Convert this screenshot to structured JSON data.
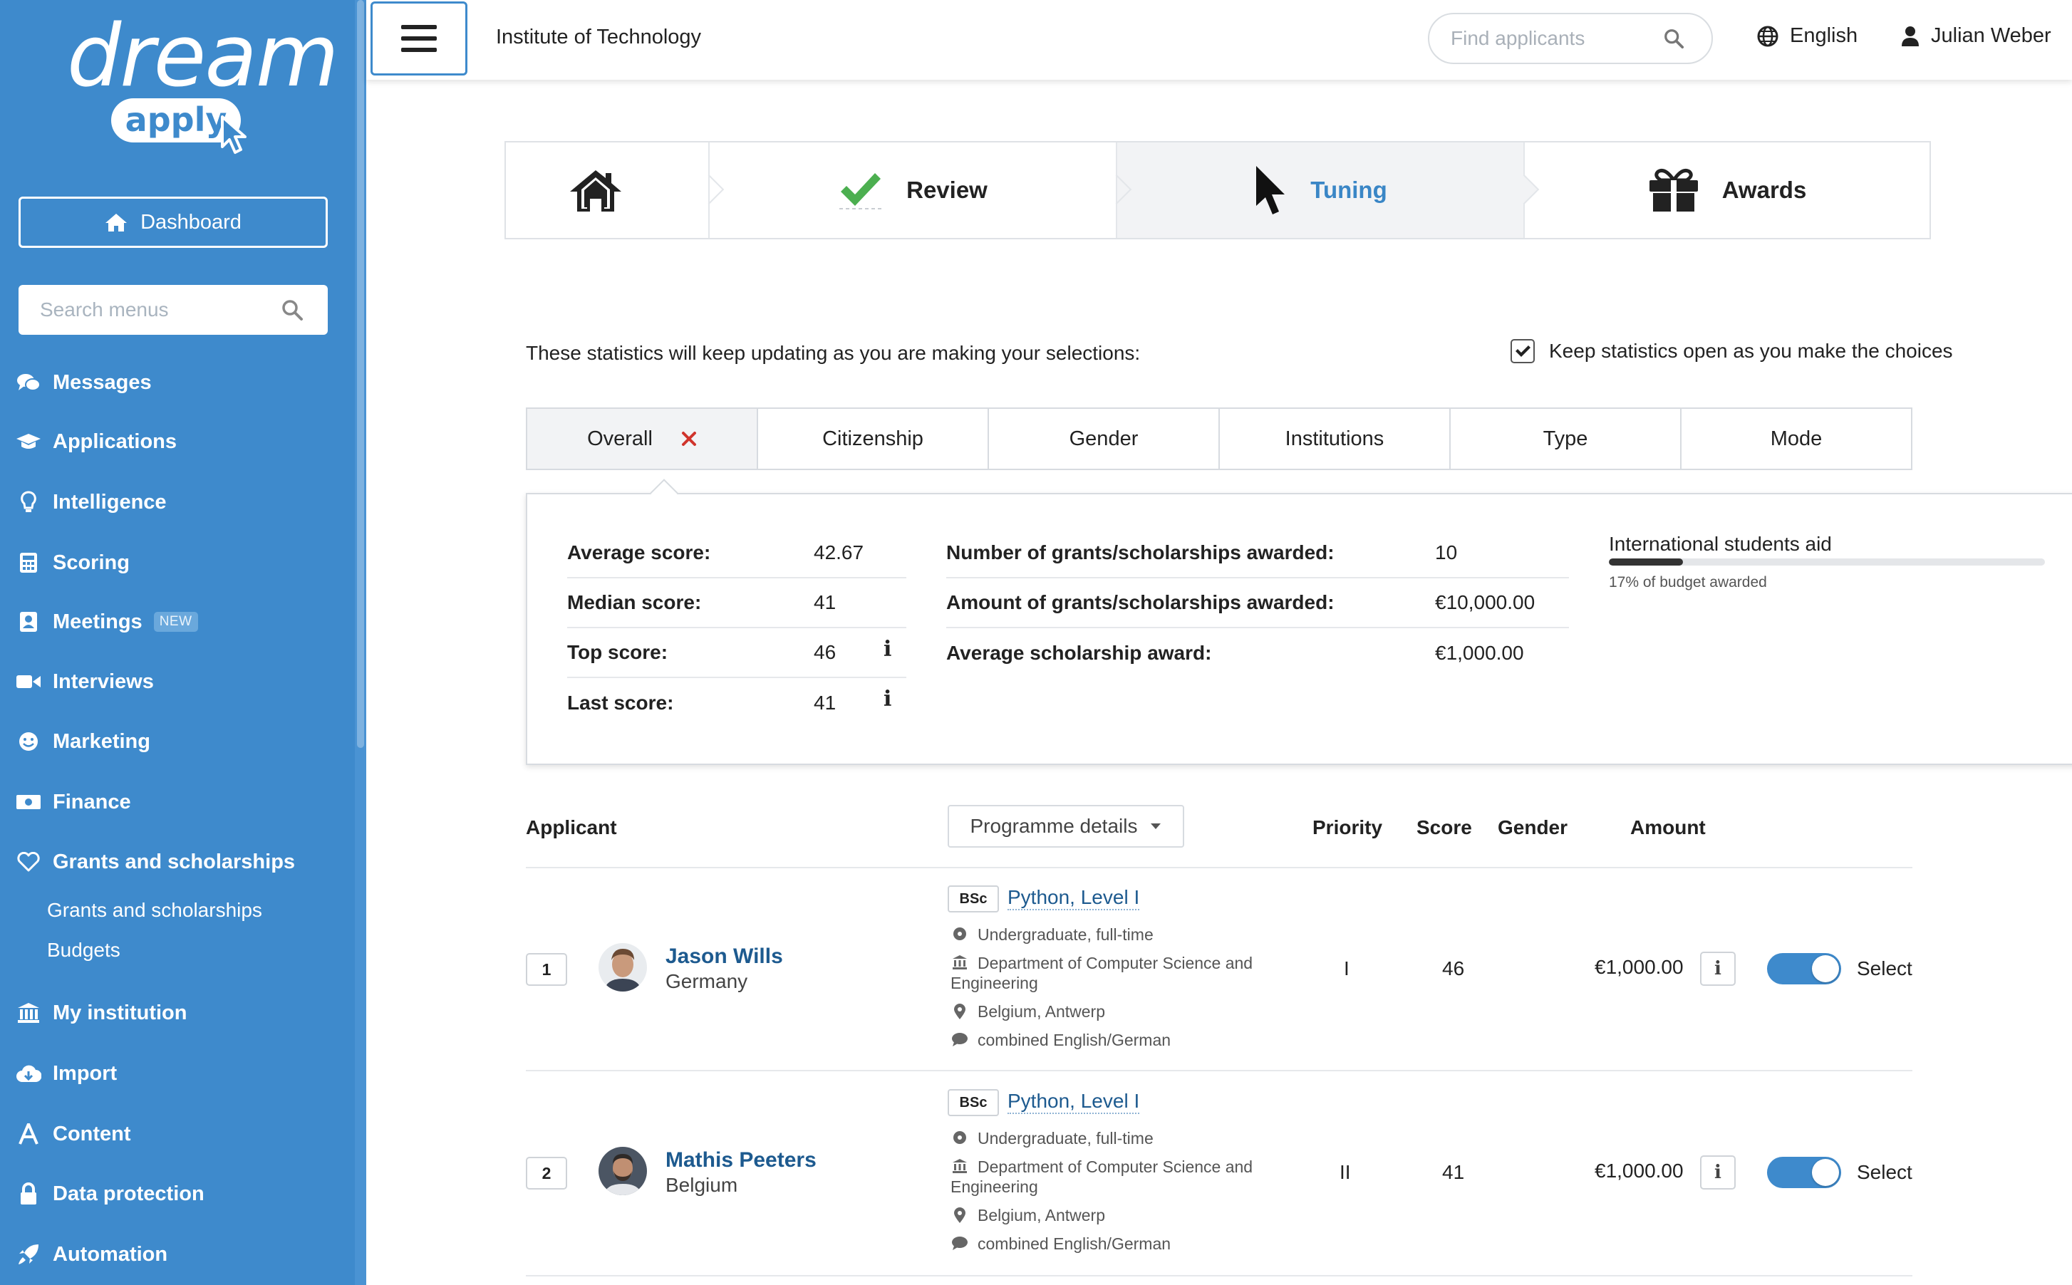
{
  "sidebar": {
    "logo_top": "dream",
    "logo_bottom": "apply",
    "dashboard_label": "Dashboard",
    "search_placeholder": "Search menus",
    "items": [
      {
        "label": "Messages",
        "icon": "chat-bubbles-icon"
      },
      {
        "label": "Applications",
        "icon": "graduation-cap-icon"
      },
      {
        "label": "Intelligence",
        "icon": "lightbulb-icon"
      },
      {
        "label": "Scoring",
        "icon": "calculator-icon"
      },
      {
        "label": "Meetings",
        "icon": "contact-card-icon",
        "badge": "NEW"
      },
      {
        "label": "Interviews",
        "icon": "video-camera-icon"
      },
      {
        "label": "Marketing",
        "icon": "smiley-icon"
      },
      {
        "label": "Finance",
        "icon": "banknote-icon"
      },
      {
        "label": "Grants and scholarships",
        "icon": "heart-icon"
      },
      {
        "label": "My institution",
        "icon": "bank-building-icon"
      },
      {
        "label": "Import",
        "icon": "cloud-download-icon"
      },
      {
        "label": "Content",
        "icon": "letter-a-icon"
      },
      {
        "label": "Data protection",
        "icon": "lock-icon"
      },
      {
        "label": "Automation",
        "icon": "rocket-icon"
      }
    ],
    "subitems": [
      "Grants and scholarships",
      "Budgets"
    ]
  },
  "topbar": {
    "institution": "Institute of Technology",
    "search_placeholder": "Find applicants",
    "language": "English",
    "user": "Julian Weber"
  },
  "steps": [
    {
      "label": "",
      "icon": "home-icon"
    },
    {
      "label": "Review",
      "icon": "checkmark-icon"
    },
    {
      "label": "Tuning",
      "icon": "cursor-arrow-icon",
      "active": true
    },
    {
      "label": "Awards",
      "icon": "gift-icon"
    }
  ],
  "stats": {
    "intro": "These statistics will keep updating as you are making your selections:",
    "keep_open_label": "Keep statistics open as you make the choices",
    "keep_open_checked": true,
    "tabs": [
      "Overall",
      "Citizenship",
      "Gender",
      "Institutions",
      "Type",
      "Mode"
    ],
    "active_tab": "Overall",
    "scores": [
      {
        "label": "Average score:",
        "value": "42.67"
      },
      {
        "label": "Median score:",
        "value": "41"
      },
      {
        "label": "Top score:",
        "value": "46"
      },
      {
        "label": "Last score:",
        "value": "41"
      }
    ],
    "grants": [
      {
        "label": "Number of grants/scholarships awarded:",
        "value": "10"
      },
      {
        "label": "Amount of grants/scholarships awarded:",
        "value": "€10,000.00"
      },
      {
        "label": "Average scholarship award:",
        "value": "€1,000.00"
      }
    ],
    "budget": {
      "title": "International students aid",
      "caption": "17% of budget awarded",
      "fraction": 0.17
    }
  },
  "table": {
    "headers": {
      "applicant": "Applicant",
      "programme_details": "Programme details",
      "priority": "Priority",
      "score": "Score",
      "gender": "Gender",
      "amount": "Amount"
    },
    "rows": [
      {
        "rank": "1",
        "name": "Jason Wills",
        "country": "Germany",
        "degree": "BSc",
        "programme": "Python, Level I",
        "level": "Undergraduate, full-time",
        "department_line1": "Department of Computer Science and",
        "department_line2": "Engineering",
        "location": "Belgium, Antwerp",
        "language": "combined English/German",
        "priority": "I",
        "score": "46",
        "gender": "",
        "amount": "€1,000.00",
        "selected": true,
        "select_label": "Select"
      },
      {
        "rank": "2",
        "name": "Mathis Peeters",
        "country": "Belgium",
        "degree": "BSc",
        "programme": "Python, Level I",
        "level": "Undergraduate, full-time",
        "department_line1": "Department of Computer Science and",
        "department_line2": "Engineering",
        "location": "Belgium, Antwerp",
        "language": "combined English/German",
        "priority": "II",
        "score": "41",
        "gender": "",
        "amount": "€1,000.00",
        "selected": true,
        "select_label": "Select"
      }
    ]
  },
  "colors": {
    "sidebar": "#3e8acc",
    "link": "#1d5a8f",
    "active_step": "#3a86c6",
    "check": "#4caf50",
    "close": "#d0342c"
  }
}
